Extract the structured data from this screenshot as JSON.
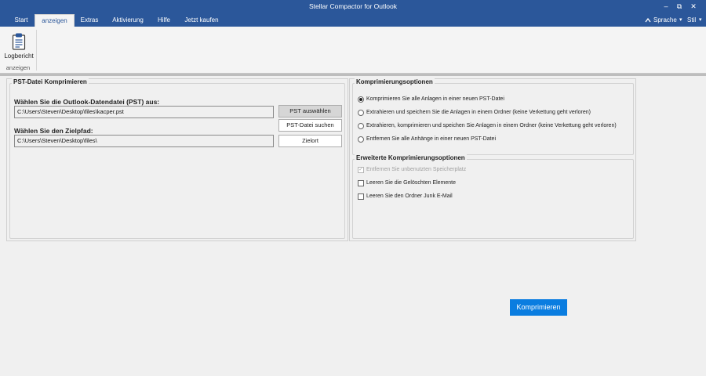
{
  "window": {
    "title": "Stellar Compactor for Outlook",
    "minimize": "–",
    "restore": "⧉",
    "close": "✕"
  },
  "menu": {
    "tabs": [
      {
        "label": "Start"
      },
      {
        "label": "anzeigen"
      },
      {
        "label": "Extras"
      },
      {
        "label": "Aktivierung"
      },
      {
        "label": "Hilfe"
      },
      {
        "label": "Jetzt kaufen"
      }
    ],
    "active_tab": "anzeigen",
    "language": "Sprache",
    "style": "Stil",
    "collapse_icon": "chevron-up-icon"
  },
  "ribbon": {
    "button_label": "Logbericht",
    "button_icon": "clipboard-log-icon",
    "group_label": "anzeigen"
  },
  "compress_panel": {
    "title": "PST-Datei Komprimieren",
    "source_label": "Wählen Sie die Outlook-Datendatei (PST) aus:",
    "source_value": "C:\\Users\\Steven\\Desktop\\files\\kacper.pst",
    "select_pst_button": "PST auswählen",
    "search_pst_button": "PST-Datei suchen",
    "target_label": "Wählen Sie den Zielpfad:",
    "target_value": "C:\\Users\\Steven\\Desktop\\files\\",
    "destination_button": "Zielort"
  },
  "options_panel": {
    "title": "Komprimierungsoptionen",
    "options": [
      {
        "label": "Komprimieren Sie alle Anlagen in einer neuen PST-Datei",
        "selected": true
      },
      {
        "label": "Extrahieren und speichern Sie die Anlagen in einem Ordner (keine Verkettung geht verloren)",
        "selected": false
      },
      {
        "label": "Extrahieren, komprimieren und speichen Sie Anlagen in einem Ordner (keine Verkettung geht verloren)",
        "selected": false
      },
      {
        "label": "Entfernen Sie alle Anhänge in einer neuen PST-Datei",
        "selected": false
      }
    ],
    "advanced_title": "Erweiterte Komprimierungsoptionen",
    "advanced": [
      {
        "label": "Entfernen Sie unbenutzten Speicherplatz",
        "checked": true,
        "disabled": true
      },
      {
        "label": "Leeren Sie die Gelöschten Elemente",
        "checked": false,
        "disabled": false
      },
      {
        "label": "Leeren Sie den Ordner Junk E-Mail",
        "checked": false,
        "disabled": false
      }
    ]
  },
  "actions": {
    "compress_button": "Komprimieren"
  },
  "colors": {
    "titlebar": "#2b579a",
    "primary_button": "#0a7de0"
  }
}
